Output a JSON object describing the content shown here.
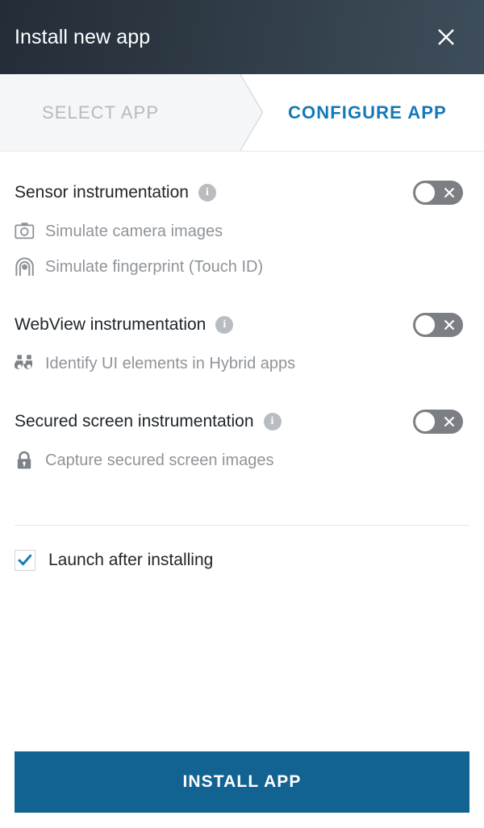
{
  "window": {
    "title": "Install new app",
    "close_icon": "close-icon"
  },
  "tabs": [
    {
      "label": "SELECT APP",
      "active": false
    },
    {
      "label": "CONFIGURE APP",
      "active": true
    }
  ],
  "colors": {
    "accent_blue": "#1279b8",
    "button_blue": "#126392",
    "header_dark": "#242d37",
    "header_light": "#3e4d5b",
    "toggle_off": "#7b7f83",
    "muted_text": "#8f9499",
    "title_text": "#20262b"
  },
  "groups": [
    {
      "title": "Sensor instrumentation",
      "info_icon": "info-icon",
      "toggle": {
        "state": "off",
        "glyph": "x"
      },
      "items": [
        {
          "icon": "camera-icon",
          "label": "Simulate camera images"
        },
        {
          "icon": "fingerprint-icon",
          "label": "Simulate fingerprint (Touch ID)"
        }
      ]
    },
    {
      "title": "WebView instrumentation",
      "info_icon": "info-icon",
      "toggle": {
        "state": "off",
        "glyph": "x"
      },
      "items": [
        {
          "icon": "binoculars-icon",
          "label": "Identify UI elements in Hybrid apps"
        }
      ]
    },
    {
      "title": "Secured screen instrumentation",
      "info_icon": "info-icon",
      "toggle": {
        "state": "off",
        "glyph": "x"
      },
      "items": [
        {
          "icon": "lock-icon",
          "label": "Capture secured screen images"
        }
      ]
    }
  ],
  "launch_option": {
    "label": "Launch after installing",
    "checked": true,
    "icon": "check-icon"
  },
  "primary_action": {
    "label": "INSTALL APP"
  },
  "info_glyph": "i"
}
